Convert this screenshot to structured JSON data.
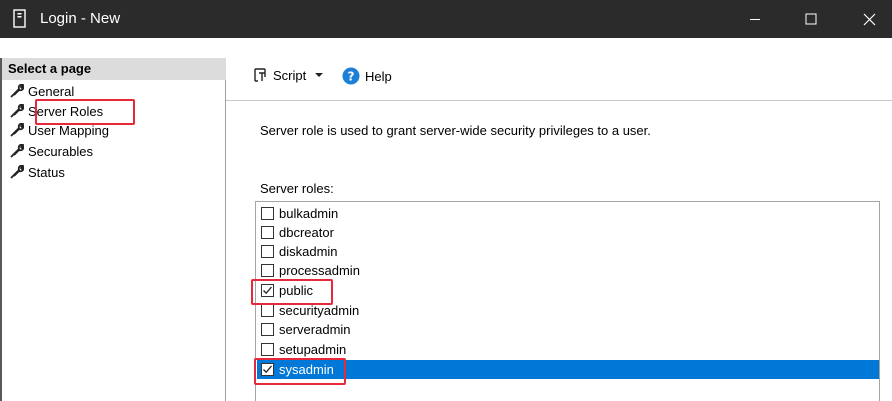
{
  "window": {
    "title": "Login - New",
    "min_glyph": "—",
    "max_glyph": "☐",
    "close_glyph": "✕"
  },
  "sidebar": {
    "header": "Select a page",
    "items": [
      {
        "label": "General",
        "icon": "wrench-icon"
      },
      {
        "label": "Server Roles",
        "icon": "wrench-icon",
        "highlighted": true
      },
      {
        "label": "User Mapping",
        "icon": "wrench-icon"
      },
      {
        "label": "Securables",
        "icon": "wrench-icon"
      },
      {
        "label": "Status",
        "icon": "wrench-icon"
      }
    ]
  },
  "toolbar": {
    "script_label": "Script",
    "help_label": "Help"
  },
  "main": {
    "description": "Server role is used to grant server-wide security privileges to a user.",
    "roles_label": "Server roles:",
    "roles": [
      {
        "name": "bulkadmin",
        "checked": false,
        "selected": false
      },
      {
        "name": "dbcreator",
        "checked": false,
        "selected": false
      },
      {
        "name": "diskadmin",
        "checked": false,
        "selected": false
      },
      {
        "name": "processadmin",
        "checked": false,
        "selected": false
      },
      {
        "name": "public",
        "checked": true,
        "selected": false
      },
      {
        "name": "securityadmin",
        "checked": false,
        "selected": false
      },
      {
        "name": "serveradmin",
        "checked": false,
        "selected": false
      },
      {
        "name": "setupadmin",
        "checked": false,
        "selected": false
      },
      {
        "name": "sysadmin",
        "checked": true,
        "selected": true
      }
    ]
  },
  "colors": {
    "titlebar": "#2b2b2b",
    "selection": "#0078d7",
    "highlight_box": "#e8283b"
  }
}
